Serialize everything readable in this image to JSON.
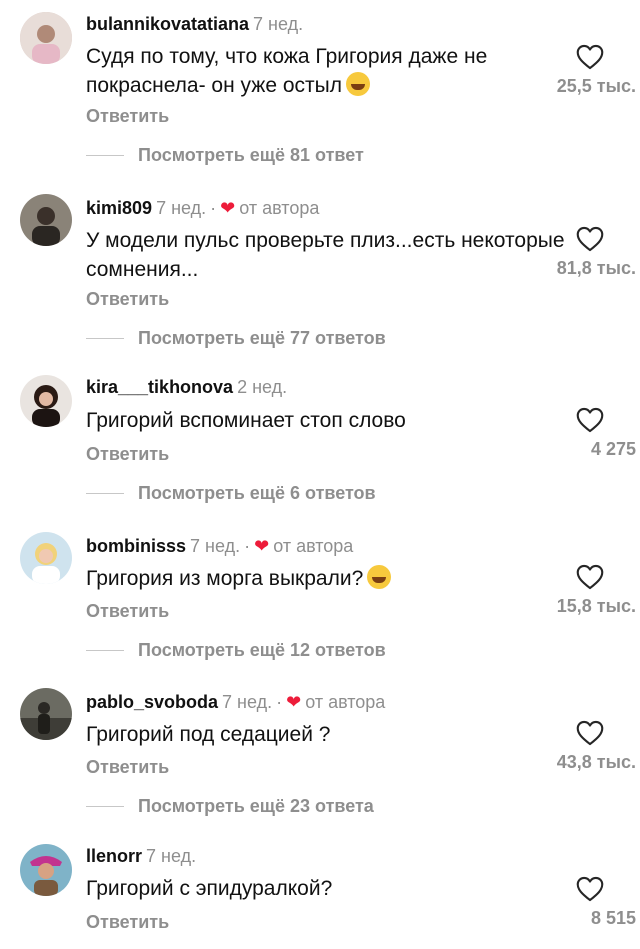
{
  "comments": [
    {
      "username": "bulannikovatatiana",
      "time": "7 нед.",
      "from_author": false,
      "author_label": "",
      "text": "Судя по тому, что кожа Григория даже не покраснела- он уже остыл",
      "emoji": "rofl",
      "reply_label": "Ответить",
      "likes": "25,5 тыс.",
      "more_replies": "Посмотреть ещё 81 ответ",
      "avatar_color": "#d9c7c0"
    },
    {
      "username": "kimi809",
      "time": "7 нед.",
      "from_author": true,
      "author_label": "от автора",
      "text": "У модели пульс проверьте плиз...есть некоторые сомнения...",
      "emoji": "",
      "reply_label": "Ответить",
      "likes": "81,8 тыс.",
      "more_replies": "Посмотреть ещё 77 ответов",
      "avatar_color": "#5b5548"
    },
    {
      "username": "kira___tikhonova",
      "time": "2 нед.",
      "from_author": false,
      "author_label": "",
      "text": "Григорий вспоминает стоп слово",
      "emoji": "",
      "reply_label": "Ответить",
      "likes": "4 275",
      "more_replies": "Посмотреть ещё 6 ответов",
      "avatar_color": "#3b2a24"
    },
    {
      "username": "bombinisss",
      "time": "7 нед.",
      "from_author": true,
      "author_label": "от автора",
      "text": "Григория из морга выкрали?",
      "emoji": "grin",
      "reply_label": "Ответить",
      "likes": "15,8 тыс.",
      "more_replies": "Посмотреть ещё 12 ответов",
      "avatar_color": "#a9c6d8"
    },
    {
      "username": "pablo_svoboda",
      "time": "7 нед.",
      "from_author": true,
      "author_label": "от автора",
      "text": "Григорий под седацией ?",
      "emoji": "",
      "reply_label": "Ответить",
      "likes": "43,8 тыс.",
      "more_replies": "Посмотреть ещё 23 ответа",
      "avatar_color": "#4a4a44"
    },
    {
      "username": "llenorr",
      "time": "7 нед.",
      "from_author": false,
      "author_label": "",
      "text": "Григорий с эпидуралкой?",
      "emoji": "",
      "reply_label": "Ответить",
      "likes": "8 515",
      "more_replies": "",
      "avatar_color": "#c58f6d"
    }
  ],
  "colors": {
    "muted": "#8e8e8e",
    "heart_red": "#ed1c3a"
  }
}
